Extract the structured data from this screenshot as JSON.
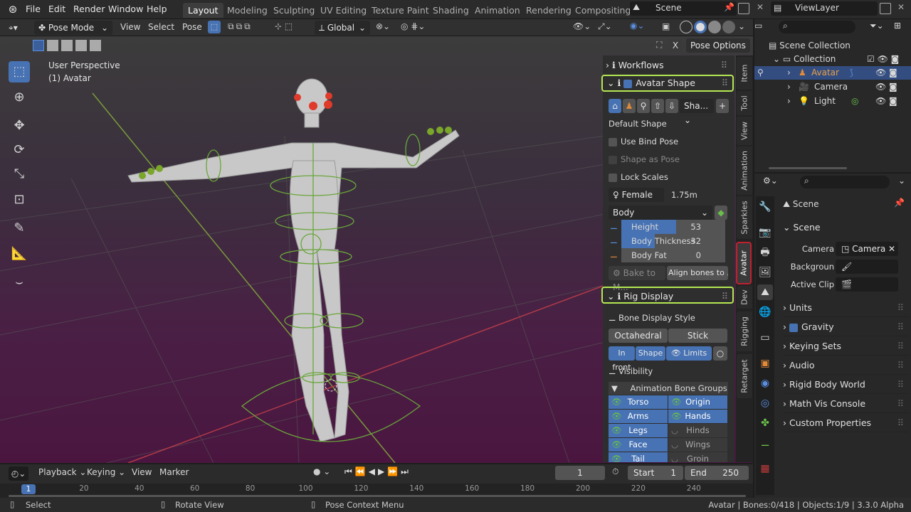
{
  "menu": {
    "items": [
      "File",
      "Edit",
      "Render",
      "Window",
      "Help"
    ]
  },
  "workspaces": [
    "Layout",
    "Modeling",
    "Sculpting",
    "UV Editing",
    "Texture Paint",
    "Shading",
    "Animation",
    "Rendering",
    "Compositing"
  ],
  "scene": {
    "name": "Scene"
  },
  "viewlayer": {
    "name": "ViewLayer"
  },
  "viewport_header": {
    "mode": "Pose Mode",
    "menus": [
      "View",
      "Select",
      "Pose"
    ],
    "orientation": "Global"
  },
  "viewport": {
    "perspective": "User Perspective",
    "object": "(1) Avatar",
    "pose_options": "Pose Options"
  },
  "npanel_tabs": [
    "Item",
    "Tool",
    "View",
    "Animation",
    "Sparkles",
    "Avatar",
    "Dev",
    "Rigging",
    "Retarget"
  ],
  "avatar_panel": {
    "workflows": "Workflows",
    "avatar_shape": "Avatar Shape",
    "shape_dropdown": "Sha...",
    "default_shape": "Default Shape",
    "use_bind_pose": "Use Bind Pose",
    "shape_as_pose": "Shape as Pose",
    "lock_scales": "Lock Scales",
    "gender": "Female",
    "height_value": "1.75m",
    "body_group": "Body",
    "sliders": [
      {
        "label": "Height",
        "value": "53",
        "fill": 0.53
      },
      {
        "label": "Body Thickness",
        "value": "32",
        "fill": 0.32
      },
      {
        "label": "Body Fat",
        "value": "0",
        "fill": 0
      }
    ],
    "bake": "Bake to M...",
    "align": "Align bones to ..."
  },
  "rig_panel": {
    "title": "Rig Display",
    "bone_display_style": "Bone Display Style",
    "octahedral": "Octahedral",
    "stick": "Stick",
    "in_front": "In front",
    "shape": "Shape",
    "limits": "Limits",
    "visibility": "Visibility",
    "groups_header": "Animation Bone Groups",
    "groups": [
      [
        "Torso",
        "Origin"
      ],
      [
        "Arms",
        "Hands"
      ],
      [
        "Legs",
        "Hinds"
      ],
      [
        "Face",
        "Wings"
      ],
      [
        "Tail",
        "Groin"
      ]
    ]
  },
  "outliner": {
    "root": "Scene Collection",
    "collection": "Collection",
    "items": [
      "Avatar",
      "Camera",
      "Light"
    ]
  },
  "properties": {
    "scene_title": "Scene",
    "scene_section": "Scene",
    "camera_label": "Camera",
    "camera_value": "Camera",
    "background_label": "Backgroun",
    "active_clip_label": "Active Clip",
    "sections": [
      "Units",
      "Gravity",
      "Keying Sets",
      "Audio",
      "Rigid Body World",
      "Math Vis Console",
      "Custom Properties"
    ]
  },
  "timeline": {
    "menus": [
      "Playback",
      "Keying",
      "View",
      "Marker"
    ],
    "current_frame": "1",
    "start_label": "Start",
    "start": "1",
    "end_label": "End",
    "end": "250",
    "ticks": [
      "1",
      "20",
      "40",
      "60",
      "80",
      "100",
      "120",
      "140",
      "160",
      "180",
      "200",
      "220",
      "240"
    ]
  },
  "status": {
    "select": "Select",
    "rotate": "Rotate View",
    "context": "Pose Context Menu",
    "info": "Avatar | Bones:0/418 | Objects:1/9 | 3.3.0 Alpha"
  },
  "colors": {
    "accent": "#4772b3",
    "highlight": "#b5e853",
    "tab_highlight": "#c21f2f"
  }
}
